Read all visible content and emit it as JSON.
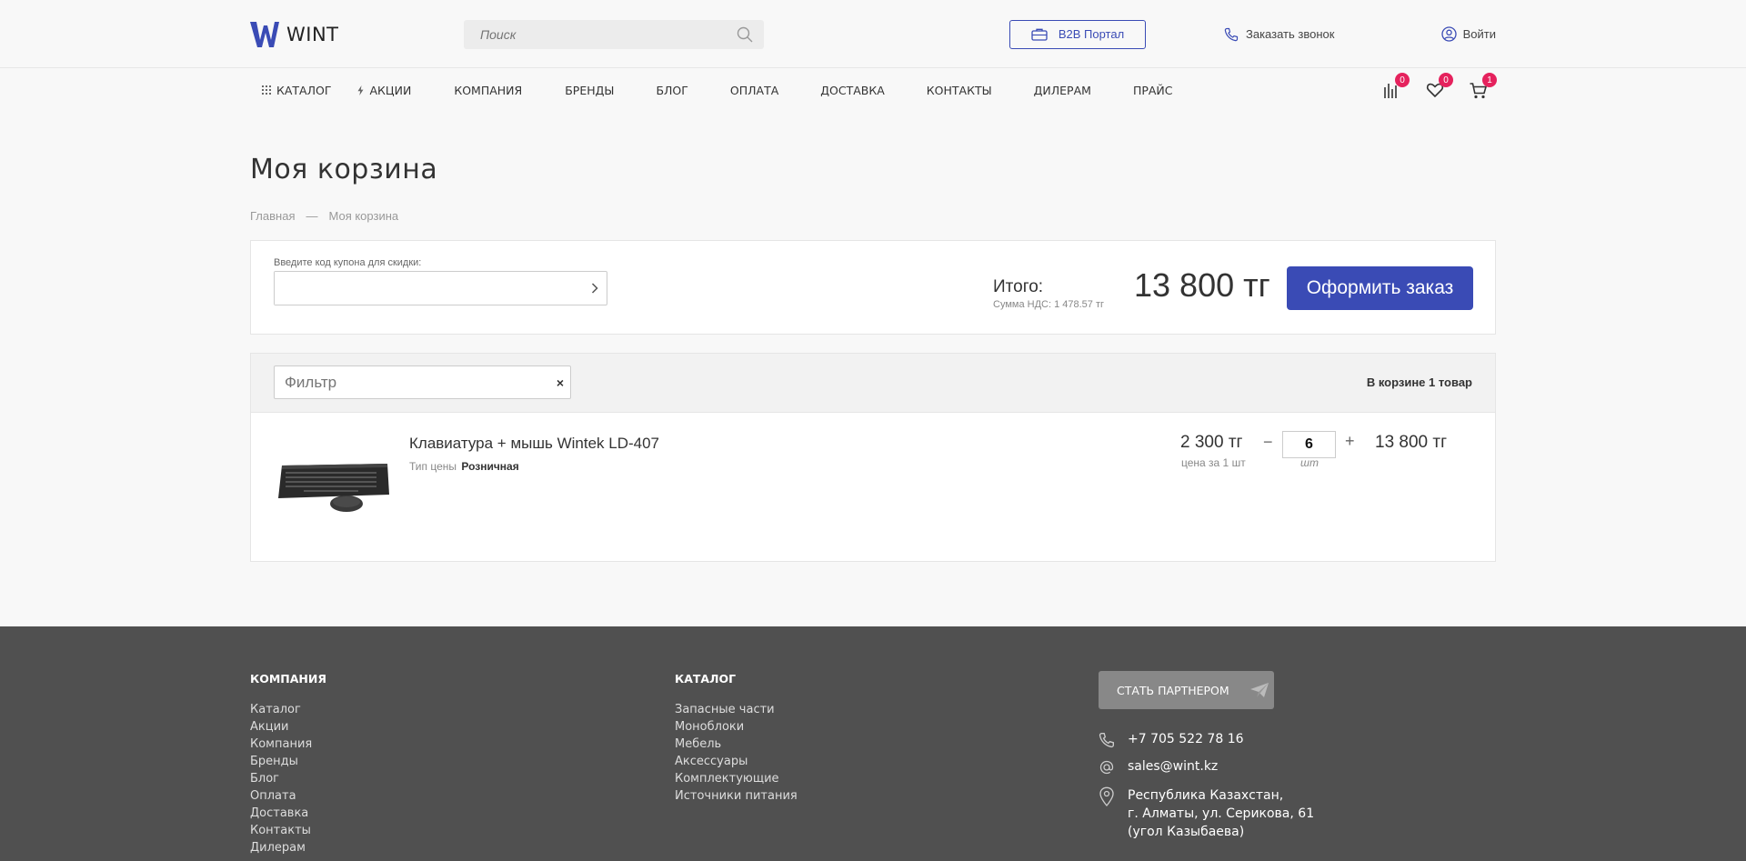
{
  "header": {
    "logo_text": "WINT",
    "search_placeholder": "Поиск",
    "b2b_label": "B2B Портал",
    "callback_label": "Заказать звонок",
    "login_label": "Войти"
  },
  "nav": {
    "items": [
      "Каталог",
      "Акции",
      "Компания",
      "Бренды",
      "Блог",
      "Оплата",
      "Доставка",
      "Контакты",
      "Дилерам",
      "Прайс"
    ],
    "compare_count": "0",
    "favorites_count": "0",
    "cart_count": "1"
  },
  "page": {
    "title": "Моя корзина",
    "breadcrumb": [
      "Главная",
      "—",
      "Моя корзина"
    ]
  },
  "summary": {
    "coupon_label": "Введите код купона для скидки:",
    "coupon_value": "",
    "total_label": "Итого:",
    "vat_text": "Сумма НДС: 1 478.57 тг",
    "total_sum": "13 800 тг",
    "checkout_label": "Оформить заказ"
  },
  "cart": {
    "filter_placeholder": "Фильтр",
    "clear_symbol": "×",
    "count_text": "В корзине 1 товар",
    "item": {
      "name": "Клавиатура + мышь Wintek LD-407",
      "price_type_label": "Тип цены",
      "price_type_value": "Розничная",
      "unit_price": "2 300 тг",
      "unit_note": "цена за 1 шт",
      "minus": "−",
      "quantity": "6",
      "qty_unit": "шт",
      "plus": "+",
      "line_total": "13 800 тг"
    }
  },
  "footer": {
    "company_title": "Компания",
    "company_links": [
      "Каталог",
      "Акции",
      "Компания",
      "Бренды",
      "Блог",
      "Оплата",
      "Доставка",
      "Контакты",
      "Дилерам"
    ],
    "catalog_title": "Каталог",
    "catalog_links": [
      "Запасные части",
      "Моноблоки",
      "Мебель",
      "Аксессуары",
      "Комплектующие",
      "Источники питания"
    ],
    "partner_label": "СТАТЬ ПАРТНЕРОМ",
    "phone": "+7 705 522 78 16",
    "email": "sales@wint.kz",
    "address_lines": [
      "Республика Казахстан,",
      "г. Алматы, ул. Серикова, 61",
      "(угол Казыбаева)"
    ]
  },
  "colors": {
    "brand_blue": "#3a4bb5",
    "badge_pink": "#e5225d",
    "footer_bg": "#505050"
  },
  "icons": [
    "logo-icon",
    "search-icon",
    "briefcase-icon",
    "phone-icon",
    "user-icon",
    "grid-icon",
    "lightning-icon",
    "compare-icon",
    "heart-icon",
    "cart-icon",
    "chevron-right-icon",
    "send-icon",
    "at-icon",
    "location-icon"
  ]
}
